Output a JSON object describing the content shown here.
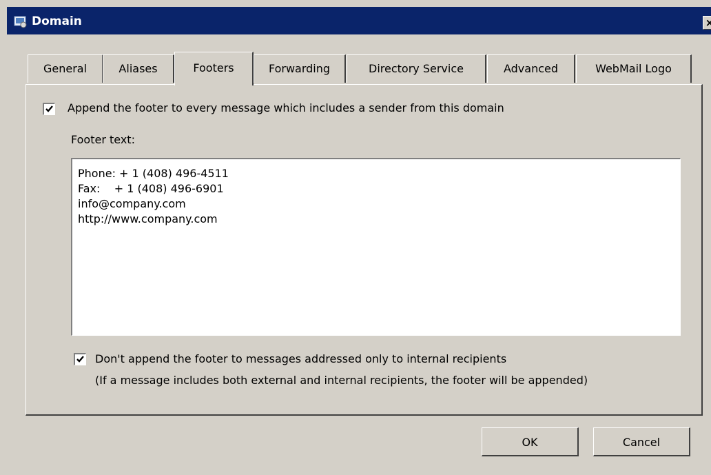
{
  "window": {
    "title": "Domain",
    "close_glyph": "×"
  },
  "tabs": [
    {
      "label": "General"
    },
    {
      "label": "Aliases"
    },
    {
      "label": "Footers",
      "active": true
    },
    {
      "label": "Forwarding"
    },
    {
      "label": "Directory Service"
    },
    {
      "label": "Advanced"
    },
    {
      "label": "WebMail Logo"
    }
  ],
  "footers": {
    "append_checkbox": {
      "checked": true,
      "label": "Append the footer to every message which includes a sender from this domain"
    },
    "footer_text_label": "Footer text:",
    "footer_lines": [
      "Phone: + 1 (408) 496-4511",
      "Fax:    + 1 (408) 496-6901",
      "info@company.com",
      "http://www.company.com"
    ],
    "internal_checkbox": {
      "checked": true,
      "label": "Don't append the footer to messages addressed only to internal recipients"
    },
    "internal_note": "(If a message includes both external and internal recipients, the footer will be appended)"
  },
  "buttons": {
    "ok": "OK",
    "cancel": "Cancel"
  },
  "icons": {
    "title": "domain-window-icon",
    "check": "checkmark-icon"
  }
}
